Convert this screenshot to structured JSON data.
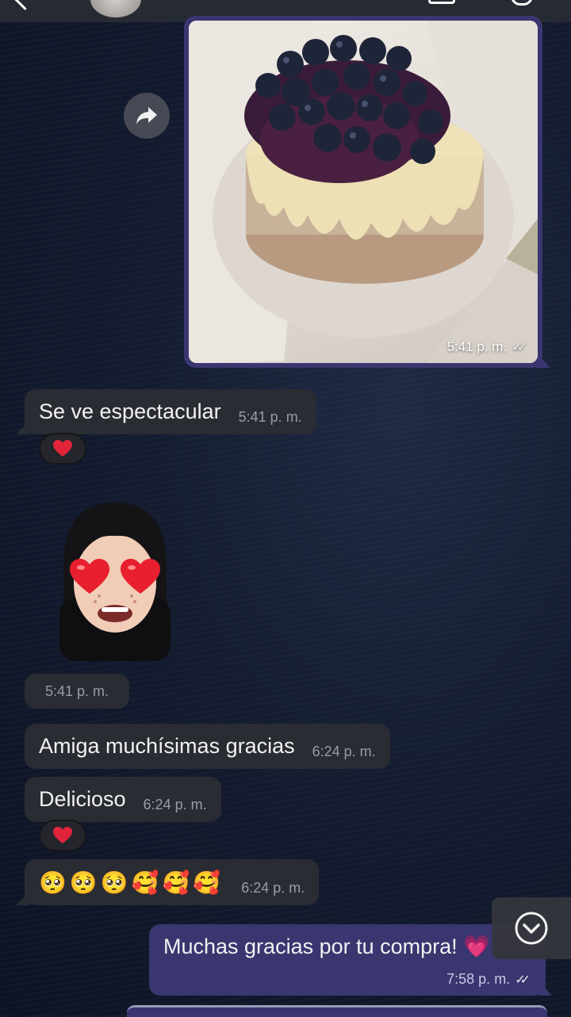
{
  "colors": {
    "outgoing_bubble": "#3a3670",
    "incoming_bubble": "#2a2c33",
    "heart": "#e0253a"
  },
  "header": {
    "back_icon": "chevron-left-icon",
    "contact_avatar": "avatar"
  },
  "photo_message": {
    "time": "5:41 p. m.",
    "status_icon": "double-check-icon",
    "forward_icon": "forward-arrow-icon"
  },
  "messages": [
    {
      "text": "Se ve espectacular",
      "time": "5:41 p. m.",
      "reaction": "❤️"
    },
    {
      "sticker": "memoji-heart-eyes",
      "time": "5:41 p. m."
    },
    {
      "text": "Amiga muchísimas gracias",
      "time": "6:24 p. m."
    },
    {
      "text": "Delicioso",
      "time": "6:24 p. m.",
      "reaction": "❤️"
    },
    {
      "text": "🥺🥺🥺🥰🥰🥰",
      "time": "6:24 p. m."
    }
  ],
  "outgoing": {
    "text": "Muchas gracias por tu compra! 💗",
    "time": "7:58 p. m.",
    "status_icon": "double-check-icon"
  },
  "scroll_button_icon": "chevron-down-circle-icon"
}
